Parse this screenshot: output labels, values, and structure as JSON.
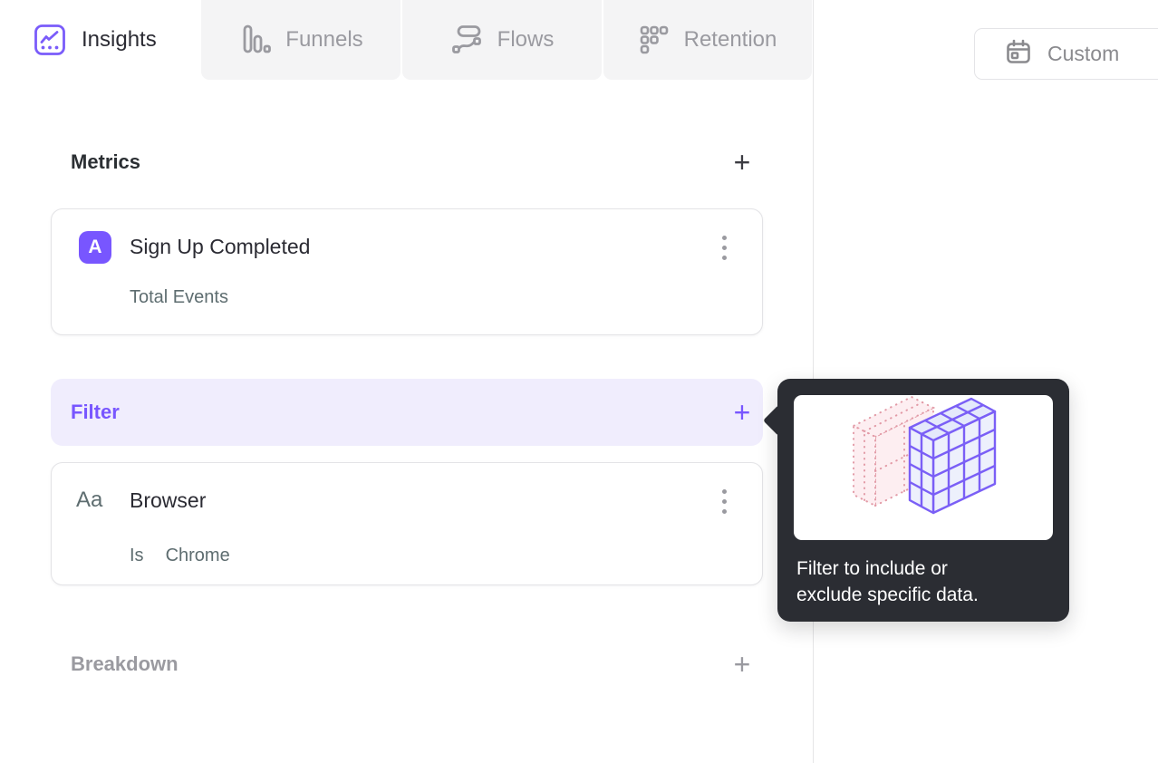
{
  "colors": {
    "accent_purple": "#7856FF",
    "filter_row_bg": "#F0EDFD",
    "tooltip_bg": "#2B2D33",
    "inactive_tab_bg": "#F4F4F5",
    "primary_text": "#2B2B33",
    "secondary_text": "#5E6D70",
    "muted_text": "#9A9AA0"
  },
  "tabs": [
    {
      "label": "Insights",
      "icon": "insights-icon",
      "active": true
    },
    {
      "label": "Funnels",
      "icon": "funnels-icon",
      "active": false
    },
    {
      "label": "Flows",
      "icon": "flows-icon",
      "active": false
    },
    {
      "label": "Retention",
      "icon": "retention-icon",
      "active": false
    }
  ],
  "toolbar": {
    "custom_button_label": "Custom",
    "custom_button_icon": "calendar-icon"
  },
  "builder": {
    "metrics": {
      "heading": "Metrics",
      "add_button": "+"
    },
    "metric_card": {
      "series_badge": "A",
      "title": "Sign Up Completed",
      "measurement": "Total Events"
    },
    "filter_row": {
      "heading": "Filter",
      "add_button": "+"
    },
    "filter_card": {
      "type_badge": "Aa",
      "property": "Browser",
      "operator": "Is",
      "value": "Chrome"
    },
    "breakdown": {
      "heading": "Breakdown",
      "add_button": "+"
    }
  },
  "tooltip": {
    "text_line1": "Filter to include or",
    "text_line2": "exclude specific data.",
    "illustration": "filter-cube-illustration"
  }
}
